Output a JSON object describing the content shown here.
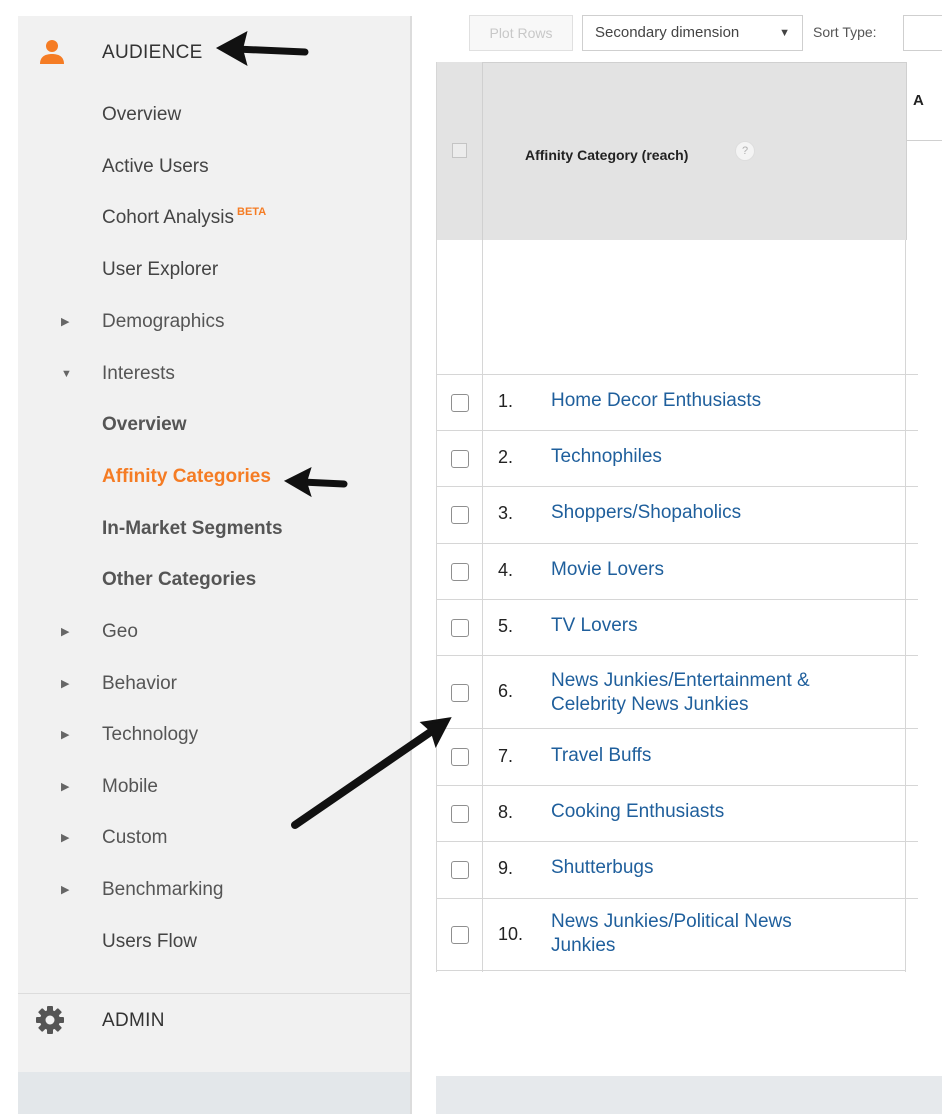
{
  "sidebar": {
    "audience_label": "AUDIENCE",
    "items": [
      {
        "label": "Overview"
      },
      {
        "label": "Active Users"
      },
      {
        "label": "Cohort Analysis",
        "badge": "BETA"
      },
      {
        "label": "User Explorer"
      },
      {
        "label": "Demographics"
      },
      {
        "label": "Interests"
      },
      {
        "label": "Overview"
      },
      {
        "label": "Affinity Categories"
      },
      {
        "label": "In-Market Segments"
      },
      {
        "label": "Other Categories"
      },
      {
        "label": "Geo"
      },
      {
        "label": "Behavior"
      },
      {
        "label": "Technology"
      },
      {
        "label": "Mobile"
      },
      {
        "label": "Custom"
      },
      {
        "label": "Benchmarking"
      },
      {
        "label": "Users Flow"
      }
    ],
    "admin_label": "ADMIN",
    "accent_color": "#f57c24"
  },
  "toolbar": {
    "plot_rows": "Plot Rows",
    "secondary_dimension": "Secondary dimension",
    "sort_type": "Sort Type:"
  },
  "table": {
    "header": {
      "column_label": "Affinity Category (reach)",
      "help_glyph": "?",
      "next_column_fragment": "A"
    },
    "rows": [
      {
        "num": "1.",
        "name": "Home Decor Enthusiasts"
      },
      {
        "num": "2.",
        "name": "Technophiles"
      },
      {
        "num": "3.",
        "name": "Shoppers/Shopaholics"
      },
      {
        "num": "4.",
        "name": "Movie Lovers"
      },
      {
        "num": "5.",
        "name": "TV Lovers"
      },
      {
        "num": "6.",
        "name": "News Junkies/Entertainment & Celebrity News Junkies"
      },
      {
        "num": "7.",
        "name": "Travel Buffs"
      },
      {
        "num": "8.",
        "name": "Cooking Enthusiasts"
      },
      {
        "num": "9.",
        "name": "Shutterbugs"
      },
      {
        "num": "10.",
        "name": "News Junkies/Political News Junkies"
      }
    ],
    "link_color": "#1f5f9c"
  }
}
